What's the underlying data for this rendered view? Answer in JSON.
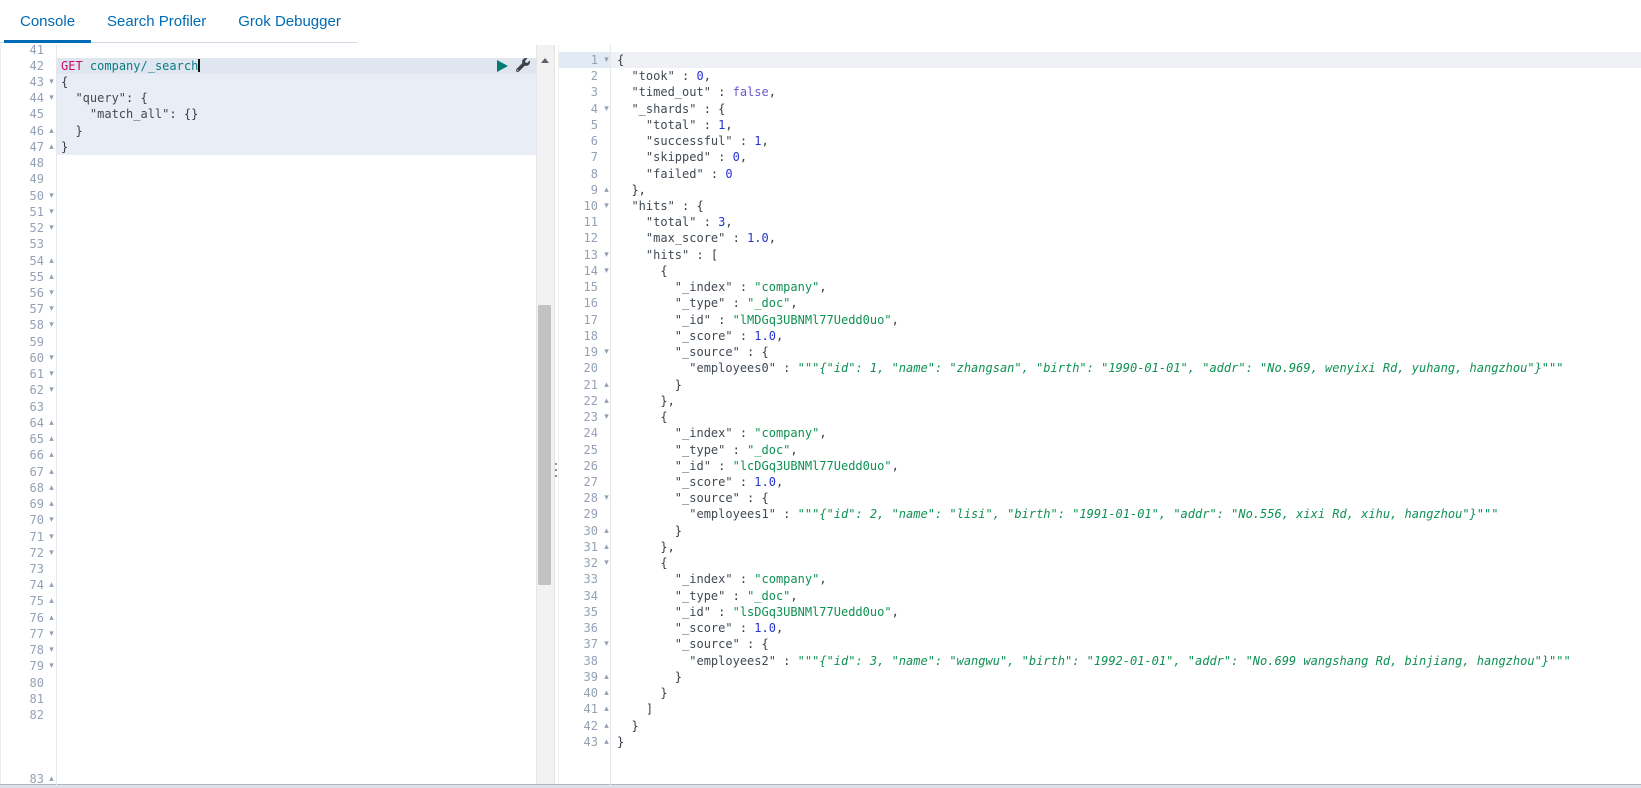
{
  "tabs": [
    {
      "label": "Console",
      "active": true
    },
    {
      "label": "Search Profiler",
      "active": false
    },
    {
      "label": "Grok Debugger",
      "active": false
    }
  ],
  "colors": {
    "tab_blue": "#006BB4",
    "method_magenta": "#C80A68",
    "url_teal": "#0a7c82",
    "string_green": "#0f9154",
    "number_blue": "#2433d0",
    "boolean_purple": "#6a5acd",
    "play_teal": "#017D73"
  },
  "icons": {
    "play_icon": "triangle-right",
    "wrench_icon": "wrench",
    "scroll_up_icon": "triangle-up",
    "drag_handle_icon": "vertical-dots",
    "fold_open_icon": "▾",
    "fold_close_icon": "▴",
    "cursor_icon": "text-caret"
  },
  "fold_glyphs": {
    "d": "▾",
    "u": "▴"
  },
  "request_editor": {
    "first_line": 41,
    "last_flow_line": 82,
    "bottom_line": 83,
    "cursor_line": 42,
    "request_block": [
      43,
      47
    ],
    "folds": {
      "43": "d",
      "44": "d",
      "46": "u",
      "47": "u",
      "50": "d",
      "51": "d",
      "52": "d",
      "54": "u",
      "55": "u",
      "56": "d",
      "57": "d",
      "58": "d",
      "60": "d",
      "61": "d",
      "62": "d",
      "64": "u",
      "65": "u",
      "66": "u",
      "67": "u",
      "68": "u",
      "69": "u",
      "70": "d",
      "71": "d",
      "72": "d",
      "74": "u",
      "75": "u",
      "76": "u",
      "77": "d",
      "78": "d",
      "79": "d",
      "83": "u"
    },
    "lines": {
      "42": [
        [
          "m",
          "GET"
        ],
        [
          "p",
          " "
        ],
        [
          "u",
          "company/_search"
        ],
        [
          "cursor",
          ""
        ]
      ],
      "43": [
        [
          "p",
          "{"
        ]
      ],
      "44": [
        [
          "p",
          "  "
        ],
        [
          "k",
          "\"query\""
        ],
        [
          "p",
          ": {"
        ]
      ],
      "45": [
        [
          "p",
          "    "
        ],
        [
          "k",
          "\"match_all\""
        ],
        [
          "p",
          ": {}"
        ]
      ],
      "46": [
        [
          "p",
          "  }"
        ]
      ],
      "47": [
        [
          "p",
          "}"
        ]
      ]
    }
  },
  "response_editor": {
    "first_line": 1,
    "last_line": 43,
    "active_line": 1,
    "folds": {
      "1": "d",
      "4": "d",
      "9": "u",
      "10": "d",
      "13": "d",
      "14": "d",
      "19": "d",
      "21": "u",
      "22": "u",
      "23": "d",
      "28": "d",
      "30": "u",
      "31": "u",
      "32": "d",
      "37": "d",
      "39": "u",
      "40": "u",
      "41": "u",
      "42": "u",
      "43": "u"
    },
    "lines": {
      "1": [
        [
          "p",
          "{"
        ]
      ],
      "2": [
        [
          "k",
          "  \"took\""
        ],
        [
          "p",
          " : "
        ],
        [
          "n",
          "0"
        ],
        [
          "p",
          ","
        ]
      ],
      "3": [
        [
          "k",
          "  \"timed_out\""
        ],
        [
          "p",
          " : "
        ],
        [
          "b",
          "false"
        ],
        [
          "p",
          ","
        ]
      ],
      "4": [
        [
          "k",
          "  \"_shards\""
        ],
        [
          "p",
          " : {"
        ]
      ],
      "5": [
        [
          "k",
          "    \"total\""
        ],
        [
          "p",
          " : "
        ],
        [
          "n",
          "1"
        ],
        [
          "p",
          ","
        ]
      ],
      "6": [
        [
          "k",
          "    \"successful\""
        ],
        [
          "p",
          " : "
        ],
        [
          "n",
          "1"
        ],
        [
          "p",
          ","
        ]
      ],
      "7": [
        [
          "k",
          "    \"skipped\""
        ],
        [
          "p",
          " : "
        ],
        [
          "n",
          "0"
        ],
        [
          "p",
          ","
        ]
      ],
      "8": [
        [
          "k",
          "    \"failed\""
        ],
        [
          "p",
          " : "
        ],
        [
          "n",
          "0"
        ]
      ],
      "9": [
        [
          "p",
          "  },"
        ]
      ],
      "10": [
        [
          "k",
          "  \"hits\""
        ],
        [
          "p",
          " : {"
        ]
      ],
      "11": [
        [
          "k",
          "    \"total\""
        ],
        [
          "p",
          " : "
        ],
        [
          "n",
          "3"
        ],
        [
          "p",
          ","
        ]
      ],
      "12": [
        [
          "k",
          "    \"max_score\""
        ],
        [
          "p",
          " : "
        ],
        [
          "n",
          "1.0"
        ],
        [
          "p",
          ","
        ]
      ],
      "13": [
        [
          "k",
          "    \"hits\""
        ],
        [
          "p",
          " : ["
        ]
      ],
      "14": [
        [
          "p",
          "      {"
        ]
      ],
      "15": [
        [
          "k",
          "        \"_index\""
        ],
        [
          "p",
          " : "
        ],
        [
          "s",
          "\"company\""
        ],
        [
          "p",
          ","
        ]
      ],
      "16": [
        [
          "k",
          "        \"_type\""
        ],
        [
          "p",
          " : "
        ],
        [
          "s",
          "\"_doc\""
        ],
        [
          "p",
          ","
        ]
      ],
      "17": [
        [
          "k",
          "        \"_id\""
        ],
        [
          "p",
          " : "
        ],
        [
          "s",
          "\"lMDGq3UBNMl77Uedd0uo\""
        ],
        [
          "p",
          ","
        ]
      ],
      "18": [
        [
          "k",
          "        \"_score\""
        ],
        [
          "p",
          " : "
        ],
        [
          "n",
          "1.0"
        ],
        [
          "p",
          ","
        ]
      ],
      "19": [
        [
          "k",
          "        \"_source\""
        ],
        [
          "p",
          " : {"
        ]
      ],
      "20": [
        [
          "k",
          "          \"employees0\""
        ],
        [
          "p",
          " : "
        ],
        [
          "s",
          "\"\"\""
        ],
        [
          "i",
          "{\"id\": 1, \"name\": \"zhangsan\", \"birth\": \"1990-01-01\", \"addr\": \"No.969, wenyixi Rd, yuhang, hangzhou\"}"
        ],
        [
          "s",
          "\"\"\""
        ]
      ],
      "21": [
        [
          "p",
          "        }"
        ]
      ],
      "22": [
        [
          "p",
          "      },"
        ]
      ],
      "23": [
        [
          "p",
          "      {"
        ]
      ],
      "24": [
        [
          "k",
          "        \"_index\""
        ],
        [
          "p",
          " : "
        ],
        [
          "s",
          "\"company\""
        ],
        [
          "p",
          ","
        ]
      ],
      "25": [
        [
          "k",
          "        \"_type\""
        ],
        [
          "p",
          " : "
        ],
        [
          "s",
          "\"_doc\""
        ],
        [
          "p",
          ","
        ]
      ],
      "26": [
        [
          "k",
          "        \"_id\""
        ],
        [
          "p",
          " : "
        ],
        [
          "s",
          "\"lcDGq3UBNMl77Uedd0uo\""
        ],
        [
          "p",
          ","
        ]
      ],
      "27": [
        [
          "k",
          "        \"_score\""
        ],
        [
          "p",
          " : "
        ],
        [
          "n",
          "1.0"
        ],
        [
          "p",
          ","
        ]
      ],
      "28": [
        [
          "k",
          "        \"_source\""
        ],
        [
          "p",
          " : {"
        ]
      ],
      "29": [
        [
          "k",
          "          \"employees1\""
        ],
        [
          "p",
          " : "
        ],
        [
          "s",
          "\"\"\""
        ],
        [
          "i",
          "{\"id\": 2, \"name\": \"lisi\", \"birth\": \"1991-01-01\", \"addr\": \"No.556, xixi Rd, xihu, hangzhou\"}"
        ],
        [
          "s",
          "\"\"\""
        ]
      ],
      "30": [
        [
          "p",
          "        }"
        ]
      ],
      "31": [
        [
          "p",
          "      },"
        ]
      ],
      "32": [
        [
          "p",
          "      {"
        ]
      ],
      "33": [
        [
          "k",
          "        \"_index\""
        ],
        [
          "p",
          " : "
        ],
        [
          "s",
          "\"company\""
        ],
        [
          "p",
          ","
        ]
      ],
      "34": [
        [
          "k",
          "        \"_type\""
        ],
        [
          "p",
          " : "
        ],
        [
          "s",
          "\"_doc\""
        ],
        [
          "p",
          ","
        ]
      ],
      "35": [
        [
          "k",
          "        \"_id\""
        ],
        [
          "p",
          " : "
        ],
        [
          "s",
          "\"lsDGq3UBNMl77Uedd0uo\""
        ],
        [
          "p",
          ","
        ]
      ],
      "36": [
        [
          "k",
          "        \"_score\""
        ],
        [
          "p",
          " : "
        ],
        [
          "n",
          "1.0"
        ],
        [
          "p",
          ","
        ]
      ],
      "37": [
        [
          "k",
          "        \"_source\""
        ],
        [
          "p",
          " : {"
        ]
      ],
      "38": [
        [
          "k",
          "          \"employees2\""
        ],
        [
          "p",
          " : "
        ],
        [
          "s",
          "\"\"\""
        ],
        [
          "i",
          "{\"id\": 3, \"name\": \"wangwu\", \"birth\": \"1992-01-01\", \"addr\": \"No.699 wangshang Rd, binjiang, hangzhou\"}"
        ],
        [
          "s",
          "\"\"\""
        ]
      ],
      "39": [
        [
          "p",
          "        }"
        ]
      ],
      "40": [
        [
          "p",
          "      }"
        ]
      ],
      "41": [
        [
          "p",
          "    ]"
        ]
      ],
      "42": [
        [
          "p",
          "  }"
        ]
      ],
      "43": [
        [
          "p",
          "}"
        ]
      ]
    }
  }
}
